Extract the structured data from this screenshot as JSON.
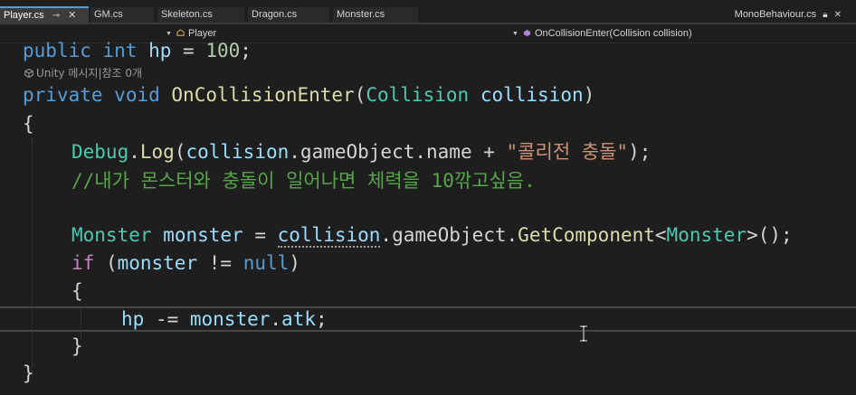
{
  "tabs": [
    {
      "label": "Player.cs",
      "active": true,
      "pinned": true,
      "closable": true
    },
    {
      "label": "GM.cs",
      "active": false
    },
    {
      "label": "Skeleton.cs",
      "active": false
    },
    {
      "label": "Dragon.cs",
      "active": false
    },
    {
      "label": "Monster.cs",
      "active": false
    }
  ],
  "right_tab": {
    "label": "MonoBehaviour.cs"
  },
  "navbar": {
    "class_dropdown": "Player",
    "member_dropdown": "OnCollisionEnter(Collision collision)"
  },
  "codelens": "Unity 메시지|참조 0개",
  "code": {
    "l1": {
      "kw1": "public",
      "kw2": "int",
      "name": "hp",
      "eq": " = ",
      "val": "100",
      "semi": ";"
    },
    "l2": {
      "kw1": "private",
      "kw2": "void",
      "fn": "OnCollisionEnter",
      "p1": "(",
      "ty": "Collision",
      "param": "collision",
      "p2": ")"
    },
    "l3": "{",
    "l4": {
      "cls": "Debug",
      "dot1": ".",
      "fn": "Log",
      "p1": "(",
      "v1": "collision",
      "dot2": ".",
      "v2": "gameObject",
      "dot3": ".",
      "v3": "name",
      "plus": " + ",
      "str": "\"콜리전 충돌\"",
      "end": ");"
    },
    "l5": "//내가 몬스터와 충돌이 일어나면 체력을 10깎고싶음.",
    "l6": {
      "ty": "Monster",
      "var": "monster",
      "eq": " = ",
      "v1": "collision",
      "dot1": ".",
      "v2": "gameObject",
      "dot2": ".",
      "fn": "GetComponent",
      "lt": "<",
      "gen": "Monster",
      "end": ">();"
    },
    "l7": {
      "kw": "if",
      "p1": " (",
      "var": "monster",
      "op": " != ",
      "lit": "null",
      "p2": ")"
    },
    "l8": "{",
    "l9": {
      "var": "hp",
      "op": " -= ",
      "obj": "monster",
      "dot": ".",
      "field": "atk",
      "semi": ";"
    },
    "l10": "}",
    "l11": "}"
  },
  "colors": {
    "background": "#1e1e1e",
    "keyword": "#569cd6",
    "type": "#4ec9b0",
    "method": "#dcdcaa",
    "variable": "#9cdcfe",
    "number": "#b5cea8",
    "string": "#ce9178",
    "comment": "#57a64a",
    "control": "#c586c0"
  }
}
